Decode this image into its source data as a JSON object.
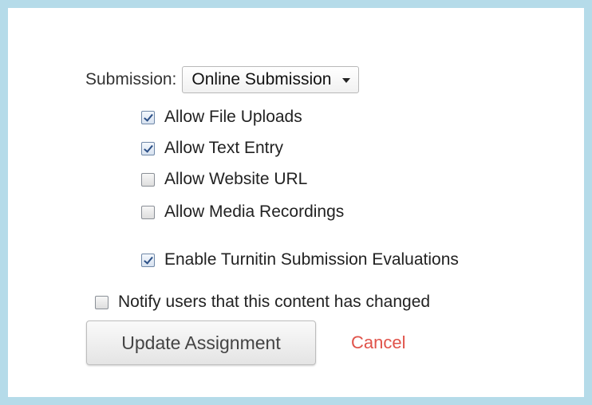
{
  "submission": {
    "label": "Submission:",
    "selected_option": "Online Submission"
  },
  "options": [
    {
      "label": "Allow File Uploads",
      "checked": true
    },
    {
      "label": "Allow Text Entry",
      "checked": true
    },
    {
      "label": "Allow Website URL",
      "checked": false
    },
    {
      "label": "Allow Media Recordings",
      "checked": false
    }
  ],
  "turnitin": {
    "label": "Enable Turnitin Submission Evaluations",
    "checked": true
  },
  "notify": {
    "label": "Notify users that this content has changed",
    "checked": false
  },
  "actions": {
    "update_label": "Update Assignment",
    "cancel_label": "Cancel"
  },
  "colors": {
    "frame_background": "#b5dbe9",
    "cancel_link": "#e0534a"
  }
}
